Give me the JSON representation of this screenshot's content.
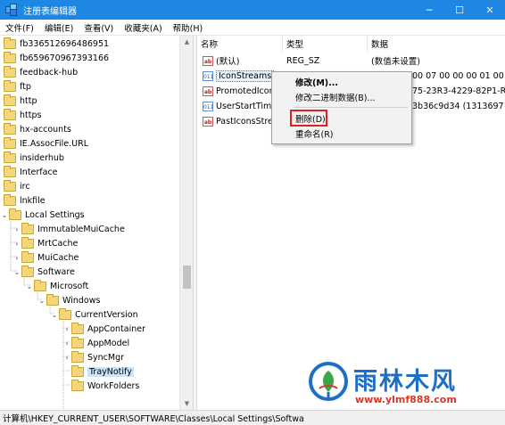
{
  "window": {
    "title": "注册表编辑器",
    "minimize_glyph": "─",
    "maximize_glyph": "☐",
    "close_glyph": "✕"
  },
  "menu": {
    "items": [
      "文件(F)",
      "编辑(E)",
      "查看(V)",
      "收藏夹(A)",
      "帮助(H)"
    ]
  },
  "tree": {
    "items": [
      {
        "label": "fb336512696486951",
        "chevron": ""
      },
      {
        "label": "fb659670967393166",
        "chevron": ""
      },
      {
        "label": "feedback-hub",
        "chevron": ""
      },
      {
        "label": "ftp",
        "chevron": ""
      },
      {
        "label": "http",
        "chevron": ""
      },
      {
        "label": "https",
        "chevron": ""
      },
      {
        "label": "hx-accounts",
        "chevron": ""
      },
      {
        "label": "IE.AssocFile.URL",
        "chevron": ""
      },
      {
        "label": "insiderhub",
        "chevron": ""
      },
      {
        "label": "Interface",
        "chevron": ""
      },
      {
        "label": "irc",
        "chevron": ""
      },
      {
        "label": "lnkfile",
        "chevron": ""
      },
      {
        "label": "Local Settings",
        "chevron": "⌄"
      },
      {
        "label": "ImmutableMuiCache",
        "chevron": "›"
      },
      {
        "label": "MrtCache",
        "chevron": "›"
      },
      {
        "label": "MuiCache",
        "chevron": "›"
      },
      {
        "label": "Software",
        "chevron": "⌄"
      },
      {
        "label": "Microsoft",
        "chevron": "⌄"
      },
      {
        "label": "Windows",
        "chevron": "⌄"
      },
      {
        "label": "CurrentVersion",
        "chevron": "⌄"
      },
      {
        "label": "AppContainer",
        "chevron": "›"
      },
      {
        "label": "AppModel",
        "chevron": "›"
      },
      {
        "label": "SyncMgr",
        "chevron": "›"
      },
      {
        "label": "TrayNotify",
        "chevron": ""
      },
      {
        "label": "WorkFolders",
        "chevron": ""
      }
    ]
  },
  "columns": {
    "name": "名称",
    "type": "类型",
    "data": "数据"
  },
  "values": [
    {
      "icon_text": "ab",
      "icon": "string-value-icon",
      "name": "(默认)",
      "type": "REG_SZ",
      "data": "(数值未设置)"
    },
    {
      "icon_text": "011",
      "icon": "binary-value-icon",
      "name": "IconStreams",
      "type": "",
      "data": "00 07 00 00 00 01 00"
    },
    {
      "icon_text": "ab",
      "icon": "string-value-icon",
      "name": "PromotedIcor",
      "type": "",
      "data": "75-23R3-4229-82P1-R"
    },
    {
      "icon_text": "011",
      "icon": "binary-value-icon",
      "name": "UserStartTime",
      "type": "",
      "data": "3b36c9d34 (1313697"
    },
    {
      "icon_text": "ab",
      "icon": "string-value-icon",
      "name": "PastIconsStre",
      "type": "",
      "data": ""
    }
  ],
  "context_menu": {
    "modify": "修改(M)...",
    "modify_binary": "修改二进制数据(B)...",
    "delete": "删除(D)",
    "rename": "重命名(R)"
  },
  "statusbar": {
    "path": "计算机\\HKEY_CURRENT_USER\\SOFTWARE\\Classes\\Local Settings\\Softwa"
  },
  "watermark": {
    "title": "雨林木风",
    "url": "www.ylmf888.com"
  },
  "colors": {
    "titlebar": "#1e87e3",
    "selection": "#cce4f7",
    "highlight_box": "#e02020",
    "watermark_blue": "#1d6fc6",
    "watermark_red": "#d23a2a"
  }
}
